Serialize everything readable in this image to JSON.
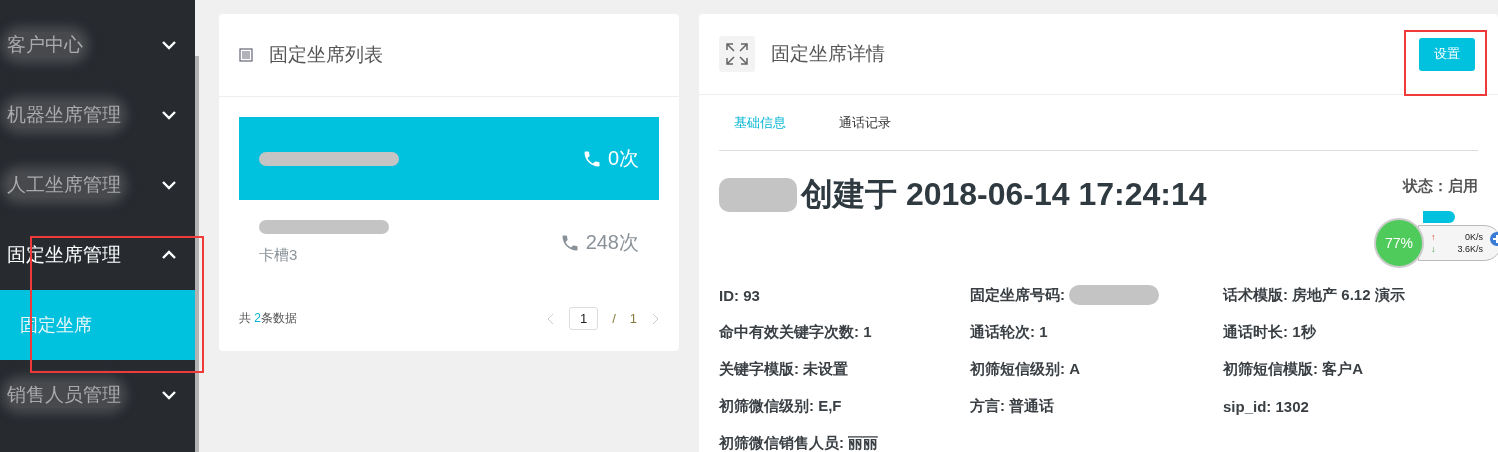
{
  "sidebar": {
    "items": [
      {
        "label": "客户中心",
        "expanded": false,
        "blurred": true
      },
      {
        "label": "机器坐席管理",
        "expanded": false,
        "blurred": true
      },
      {
        "label": "人工坐席管理",
        "expanded": false,
        "blurred": true
      },
      {
        "label": "固定坐席管理",
        "expanded": true,
        "blurred": false,
        "children": [
          {
            "label": "固定坐席",
            "selected": true
          }
        ]
      },
      {
        "label": "销售人员管理",
        "expanded": false,
        "blurred": true
      }
    ]
  },
  "list_panel": {
    "title": "固定坐席列表",
    "items": [
      {
        "calls": "0次",
        "selected": true
      },
      {
        "calls": "248次",
        "slot": "卡槽3",
        "selected": false
      }
    ],
    "footer": {
      "prefix": "共",
      "count": "2",
      "suffix": "条数据"
    },
    "pagination": {
      "page": "1",
      "separator": "/",
      "total": "1"
    }
  },
  "detail_panel": {
    "title": "固定坐席详情",
    "button": "设置",
    "tabs": [
      {
        "label": "基础信息",
        "selected": true
      },
      {
        "label": "通话记录",
        "selected": false
      }
    ],
    "heading": "创建于 2018-06-14 17:24:14",
    "status": "状态：启用",
    "fields": [
      {
        "text": "ID: 93"
      },
      {
        "text": "固定坐席号码:",
        "redacted": true
      },
      {
        "text": "话术模版: 房地产 6.12 演示"
      },
      {
        "text": "命中有效关键字次数: 1"
      },
      {
        "text": "通话轮次: 1"
      },
      {
        "text": "通话时长: 1秒"
      },
      {
        "text": "关键字模版: 未设置"
      },
      {
        "text": "初筛短信级别: A"
      },
      {
        "text": "初筛短信模版: 客户A"
      },
      {
        "text": "初筛微信级别: E,F"
      },
      {
        "text": "方言: 普通话"
      },
      {
        "text": "sip_id: 1302"
      },
      {
        "text": "初筛微信销售人员: 丽丽"
      }
    ]
  },
  "status_switch": {
    "on": true
  },
  "speed_widget": {
    "percent": "77%",
    "up_arrow": "↑",
    "upload": "0K/s",
    "down_arrow": "↓",
    "download": "3.6K/s"
  }
}
